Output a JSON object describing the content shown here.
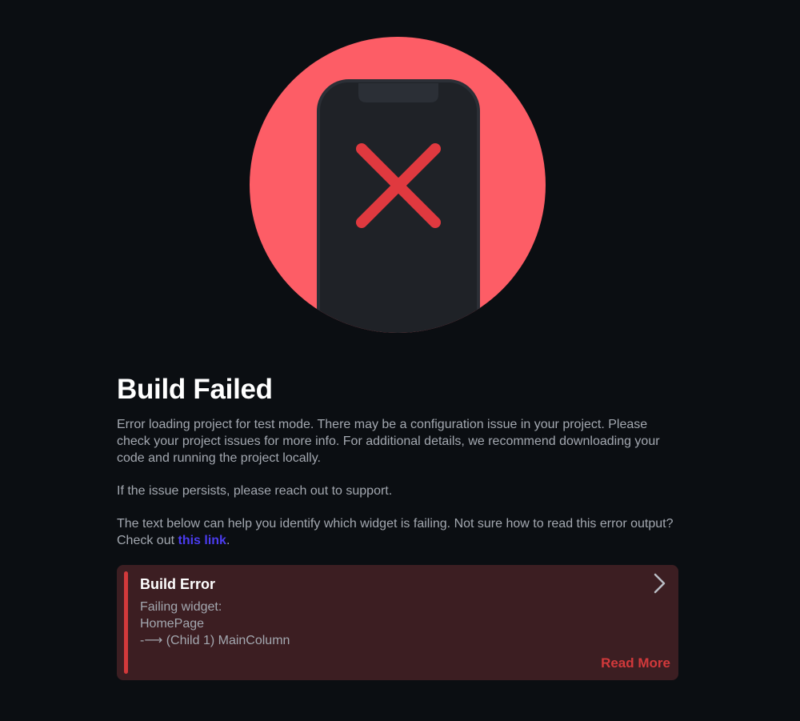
{
  "hero": {
    "image_icon": "phone-with-x-icon",
    "colors": {
      "circle": "#fd5d66",
      "phone": "#1f2227",
      "x_mark": "#e0393f"
    }
  },
  "title": "Build Failed",
  "paragraphs": {
    "p1": "Error loading project for test mode. There may be a configuration issue in your project. Please check your project issues for more info. For additional details, we recommend downloading your code and running the project locally.",
    "p2": "If the issue persists, please reach out to support.",
    "p3_before": "The text below can help you identify which widget is failing. Not sure how to read this error output? Check out ",
    "p3_link": "this link",
    "p3_after": "."
  },
  "error_card": {
    "title": "Build Error",
    "lines": [
      "Failing widget:",
      "HomePage",
      "-⟶ (Child 1) MainColumn"
    ],
    "chevron_icon": "chevron-right-icon",
    "read_more": "Read More",
    "colors": {
      "background": "#3c1e22",
      "accent": "#d2393b"
    }
  }
}
